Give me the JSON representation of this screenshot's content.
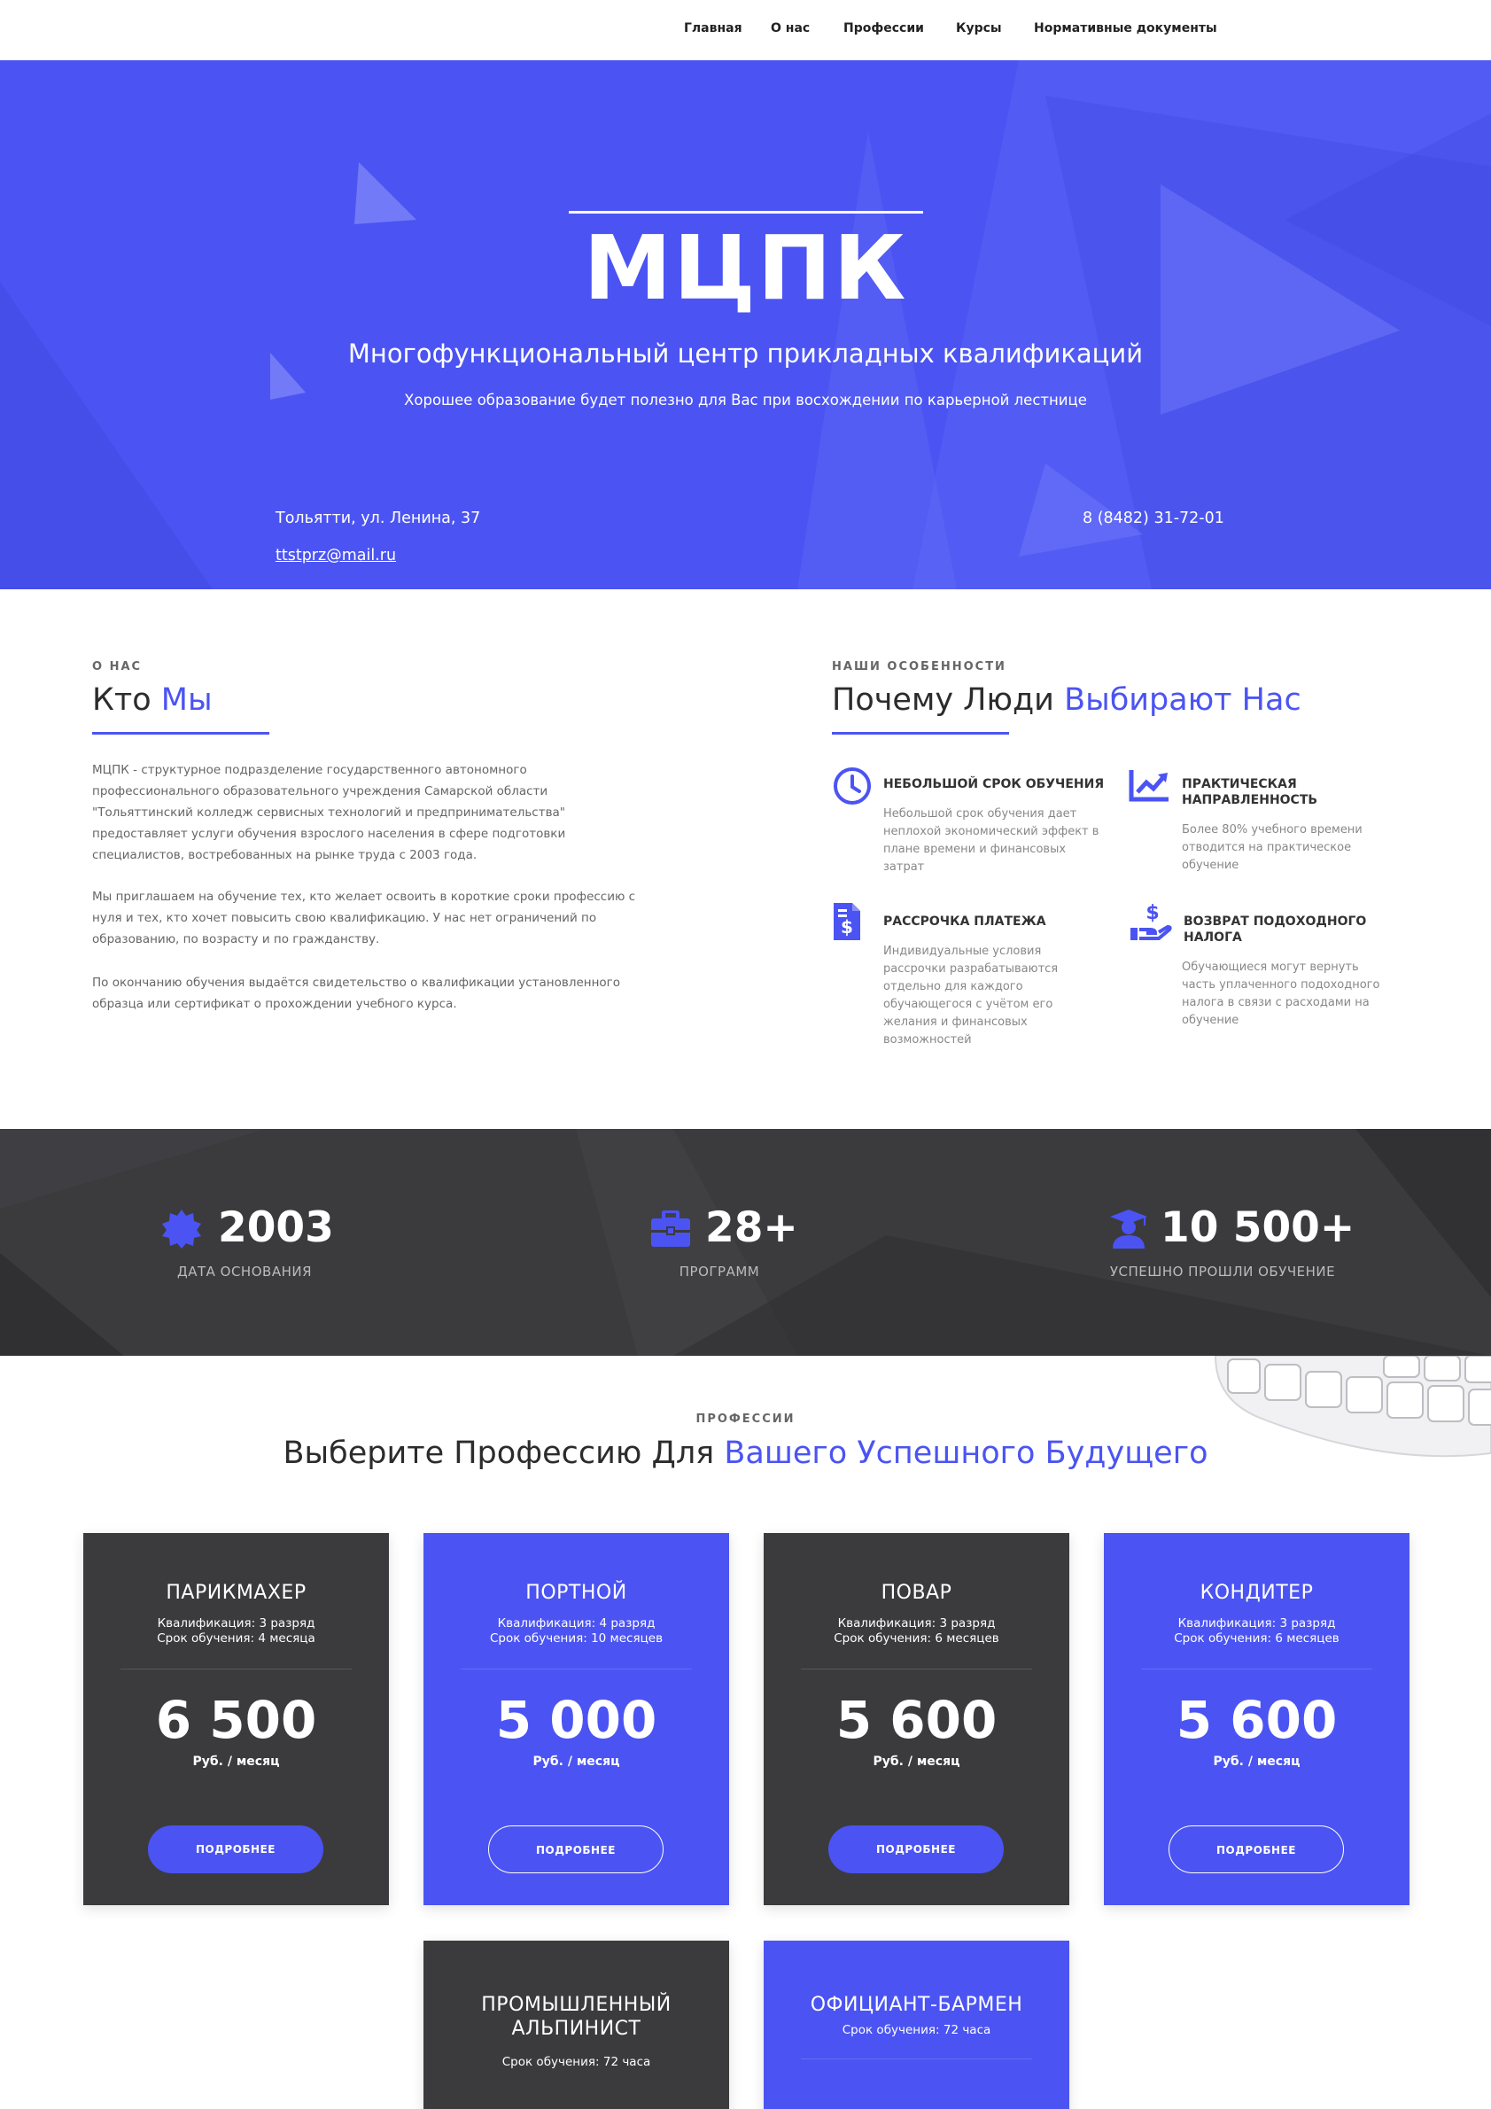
{
  "nav": {
    "items": [
      {
        "label": "Главная"
      },
      {
        "label": "О нас"
      },
      {
        "label": "Профессии"
      },
      {
        "label": "Курсы"
      },
      {
        "label": "Нормативные документы"
      }
    ]
  },
  "hero": {
    "title": "МЦПК",
    "subtitle": "Многофункциональный центр прикладных квалификаций",
    "tagline": "Хорошее образование будет полезно для Вас при восхождении по карьерной лестнице",
    "address": "Тольятти, ул. Ленина, 37",
    "phone": "8 (8482) 31-72-01",
    "email": "ttstprz@mail.ru"
  },
  "about": {
    "label": "О НАС",
    "title_part1": "Кто",
    "title_part2": "Мы",
    "paragraphs": [
      "МЦПК - структурное подразделение государственного автономного профессионального образовательного учреждения Самарской области \"Тольяттинский колледж сервисных технологий и предпринимательства\" предоставляет услуги обучения взрослого населения в сфере подготовки специалистов, востребованных на рынке труда с 2003 года.",
      "Мы приглашаем на обучение тех, кто желает освоить в короткие сроки профессию с нуля и тех, кто хочет повысить свою квалификацию. У нас нет ограничений по образованию, по возрасту и по гражданству.",
      "По окончанию обучения выдаётся свидетельство о квалификации установленного образца или сертификат о прохождении учебного курса."
    ]
  },
  "features": {
    "label": "НАШИ ОСОБЕННОСТИ",
    "title_part1": "Почему Люди",
    "title_part2": "Выбирают Нас",
    "items": [
      {
        "icon": "clock-icon",
        "title": "НЕБОЛЬШОЙ СРОК ОБУЧЕНИЯ",
        "text": "Небольшой срок обучения дает неплохой экономический эффект в плане времени и финансовых затрат"
      },
      {
        "icon": "chart-up-icon",
        "title": "ПРАКТИЧЕСКАЯ НАПРАВЛЕННОСТЬ",
        "text": "Более 80% учебного времени отводится на практическое обучение"
      },
      {
        "icon": "invoice-dollar-icon",
        "title": "РАССРОЧКА ПЛАТЕЖА",
        "text": "Индивидуальные условия рассрочки разрабатываются отдельно для каждого обучающегося с учётом его желания и финансовых возможностей"
      },
      {
        "icon": "hand-dollar-icon",
        "title": "ВОЗВРАТ ПОДОХОДНОГО НАЛОГА",
        "text": "Обучающиеся могут вернуть часть уплаченного подоходного налога в связи с расходами на обучение"
      }
    ]
  },
  "stats": [
    {
      "icon": "certificate-badge-icon",
      "value": "2003",
      "label": "ДАТА ОСНОВАНИЯ"
    },
    {
      "icon": "briefcase-icon",
      "value": "28+",
      "label": "ПРОГРАММ"
    },
    {
      "icon": "graduate-icon",
      "value": "10 500+",
      "label": "УСПЕШНО ПРОШЛИ ОБУЧЕНИЕ"
    }
  ],
  "professions": {
    "label": "ПРОФЕССИИ",
    "title_part1": "Выберите Профессию Для",
    "title_part2": "Вашего Успешного Будущего",
    "cards": [
      {
        "name": "ПАРИКМАХЕР",
        "qual": "Квалификация: 3 разряд",
        "term": "Срок обучения: 4 месяца",
        "price": "6 500",
        "unit": "Руб. / месяц",
        "button": "ПОДРОБНЕЕ"
      },
      {
        "name": "ПОРТНОЙ",
        "qual": "Квалификация: 4 разряд",
        "term": "Срок обучения: 10 месяцев",
        "price": "5 000",
        "unit": "Руб. / месяц",
        "button": "ПОДРОБНЕЕ"
      },
      {
        "name": "ПОВАР",
        "qual": "Квалификация: 3 разряд",
        "term": "Срок обучения: 6 месяцев",
        "price": "5 600",
        "unit": "Руб. / месяц",
        "button": "ПОДРОБНЕЕ"
      },
      {
        "name": "КОНДИТЕР",
        "qual": "Квалификация: 3 разряд",
        "term": "Срок обучения: 6 месяцев",
        "price": "5 600",
        "unit": "Руб. / месяц",
        "button": "ПОДРОБНЕЕ"
      },
      {
        "name_line1": "ПРОМЫШЛЕННЫЙ",
        "name_line2": "АЛЬПИНИСТ",
        "term": "Срок обучения: 72 часа"
      },
      {
        "name": "ОФИЦИАНТ-БАРМЕН",
        "term": "Срок обучения: 72 часа"
      }
    ]
  },
  "colors": {
    "accent": "#4b54f2",
    "dark": "#3b3b3e"
  }
}
